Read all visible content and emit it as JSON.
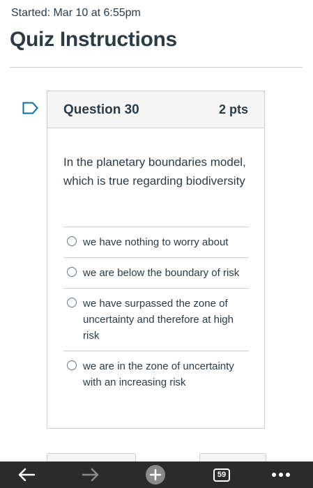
{
  "header": {
    "started": "Started: Mar 10 at 6:55pm",
    "title": "Quiz Instructions"
  },
  "question": {
    "number_label": "Question 30",
    "points": "2 pts",
    "text": "In the planetary boundaries model, which is true regarding biodiversity",
    "answers": [
      "we have nothing to worry about",
      "we are below the boundary of risk",
      "we have surpassed the zone of uncertainty and therefore at high risk",
      "we are in the zone of uncertainty with an increasing risk"
    ]
  },
  "browser_bar": {
    "tab_count": "59",
    "icons": [
      "back-arrow-icon",
      "forward-arrow-icon",
      "new-tab-plus-icon",
      "tab-count-icon",
      "more-menu-icon"
    ],
    "bar_color": "#2b2b2b"
  },
  "colors": {
    "text": "#2d3b45",
    "border": "#c7cdd1",
    "flag": "#0770a3"
  }
}
